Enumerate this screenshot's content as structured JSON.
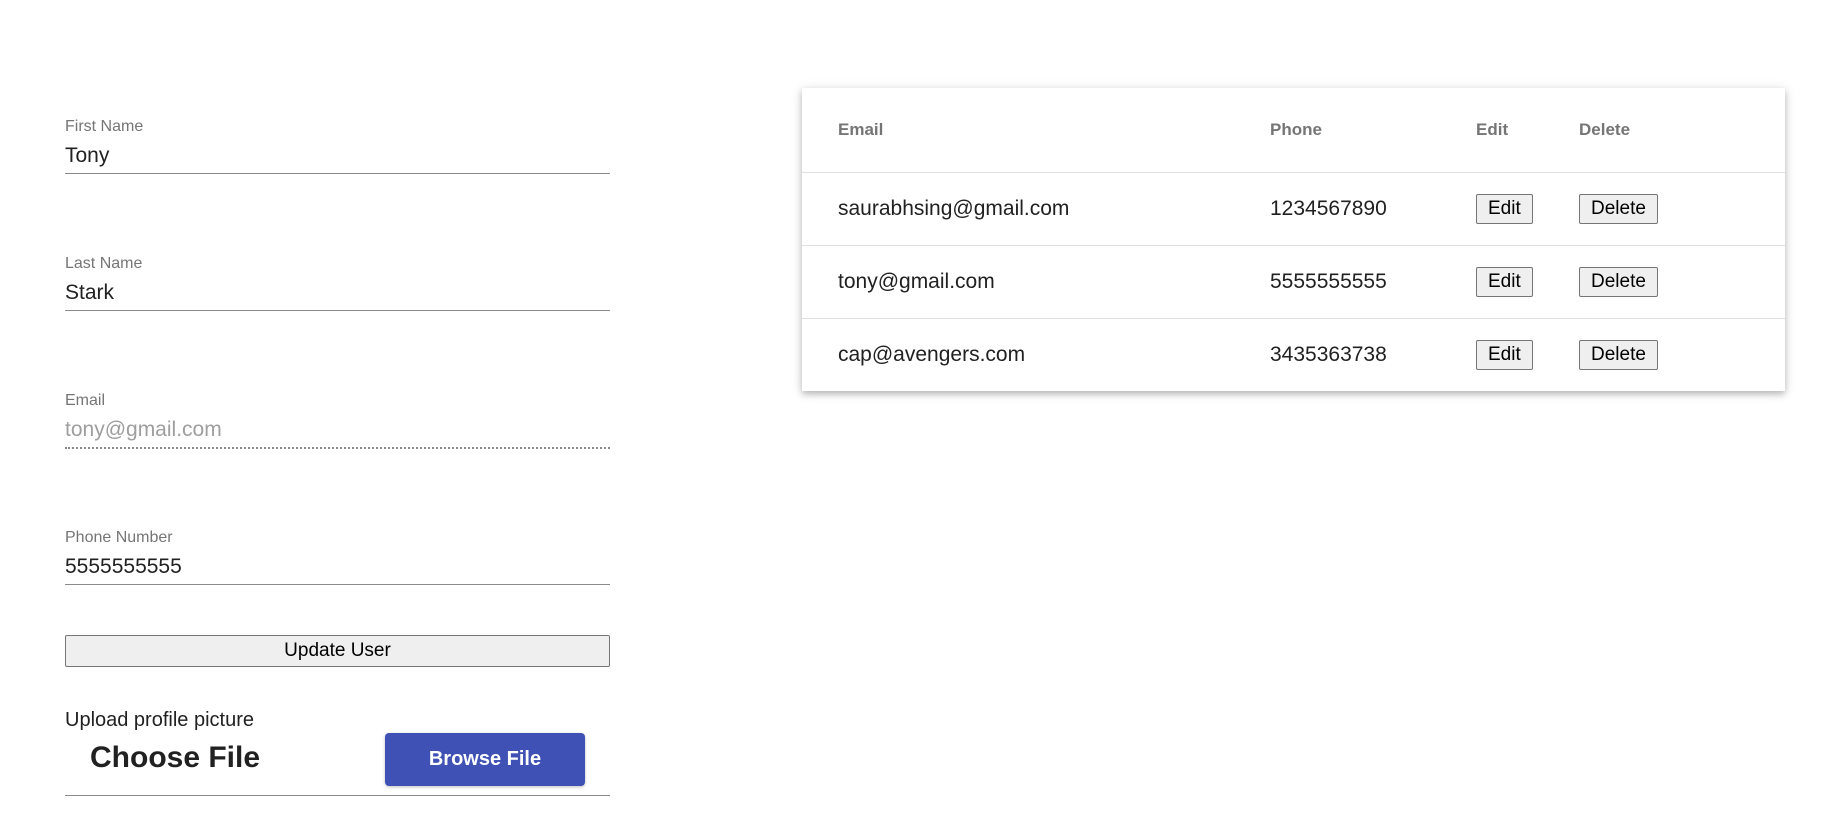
{
  "form": {
    "first_name": {
      "label": "First Name",
      "value": "Tony"
    },
    "last_name": {
      "label": "Last Name",
      "value": "Stark"
    },
    "email": {
      "label": "Email",
      "value": "tony@gmail.com"
    },
    "phone": {
      "label": "Phone Number",
      "value": "5555555555"
    },
    "update_button": "Update User",
    "upload": {
      "label": "Upload profile picture",
      "choose_file": "Choose File",
      "browse_button": "Browse File",
      "accent_color": "#3f51b5"
    }
  },
  "table": {
    "headers": {
      "email": "Email",
      "phone": "Phone",
      "edit": "Edit",
      "delete": "Delete"
    },
    "rows": [
      {
        "email": "saurabhsing@gmail.com",
        "phone": "1234567890",
        "edit": "Edit",
        "delete": "Delete"
      },
      {
        "email": "tony@gmail.com",
        "phone": "5555555555",
        "edit": "Edit",
        "delete": "Delete"
      },
      {
        "email": "cap@avengers.com",
        "phone": "3435363738",
        "edit": "Edit",
        "delete": "Delete"
      }
    ]
  }
}
